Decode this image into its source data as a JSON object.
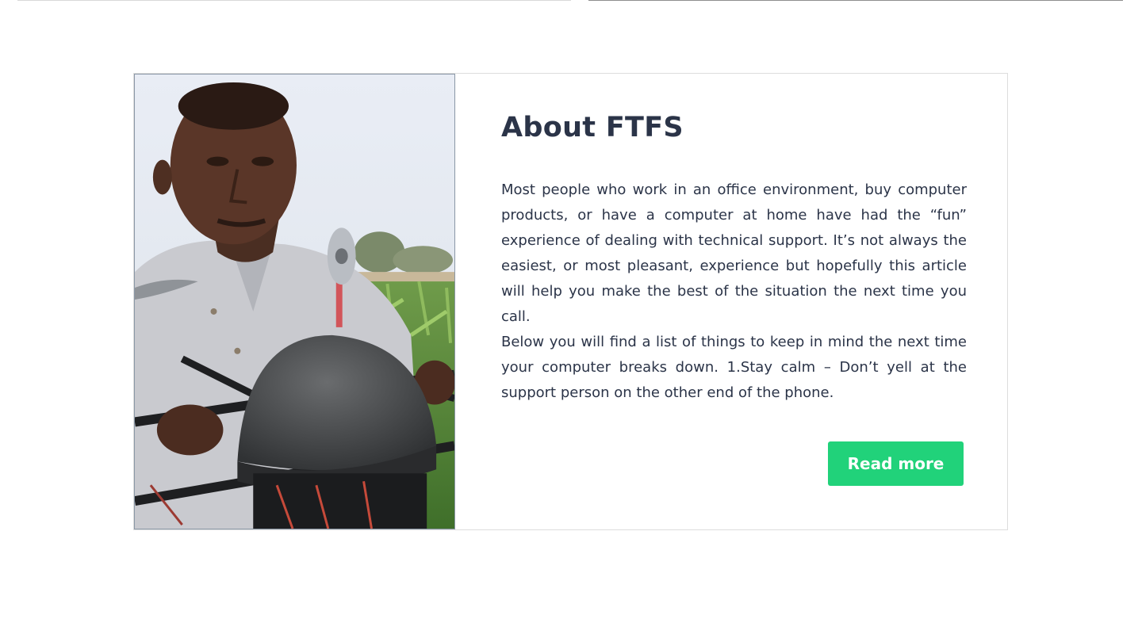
{
  "about": {
    "title": "About FTFS",
    "paragraph_1": "Most people who work in an office environment, buy computer products, or have a computer at home have had the “fun” experience of dealing with technical support. It’s not always the easiest, or most pleasant, experience but hopefully this article will help you make the best of the situation the next time you call.",
    "paragraph_2": "Below you will find a list of things to keep in mind the next time your computer breaks down. 1.Stay calm – Don’t yell at the support person on the other end of the phone.",
    "button_label": "Read more"
  },
  "colors": {
    "heading": "#2b3448",
    "body_text": "#2b3448",
    "button_bg": "#21d27a",
    "button_text": "#ffffff",
    "card_border": "#dddddd"
  }
}
